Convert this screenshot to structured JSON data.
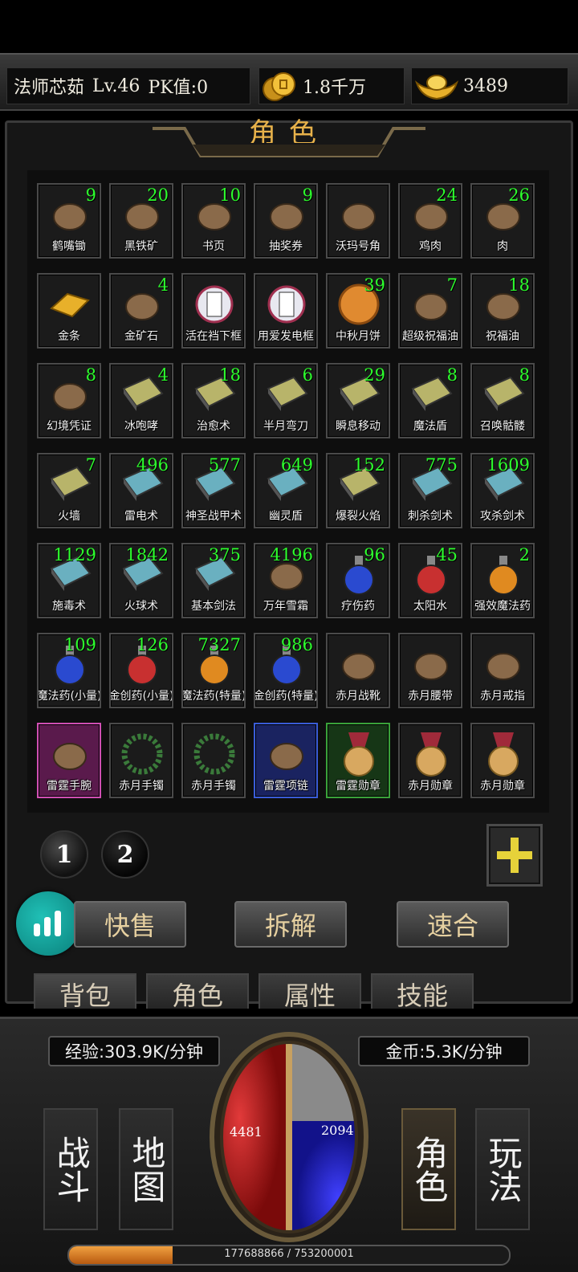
{
  "player": {
    "name": "法师芯茹",
    "level": "Lv.46",
    "pk": "PK值:0"
  },
  "currency": {
    "gold": "1.8千万",
    "ingot": "3489"
  },
  "panel_title": "角色",
  "items": [
    {
      "name": "鹤嘴锄",
      "count": "9",
      "icon": "pickaxe-icon"
    },
    {
      "name": "黑铁矿",
      "count": "20",
      "icon": "black-iron-ore-icon"
    },
    {
      "name": "书页",
      "count": "10",
      "icon": "book-page-icon"
    },
    {
      "name": "抽奖券",
      "count": "9",
      "icon": "lottery-ticket-icon"
    },
    {
      "name": "沃玛号角",
      "count": "",
      "icon": "horn-icon"
    },
    {
      "name": "鸡肉",
      "count": "24",
      "icon": "chicken-icon"
    },
    {
      "name": "肉",
      "count": "26",
      "icon": "meat-icon"
    },
    {
      "name": "金条",
      "count": "",
      "icon": "gold-bar-icon"
    },
    {
      "name": "金矿石",
      "count": "4",
      "icon": "gold-ore-icon"
    },
    {
      "name": "活在裆下框",
      "count": "",
      "icon": "frame-icon"
    },
    {
      "name": "用爱发电框",
      "count": "",
      "icon": "frame-icon"
    },
    {
      "name": "中秋月饼",
      "count": "39",
      "icon": "mooncake-icon"
    },
    {
      "name": "超级祝福油",
      "count": "7",
      "icon": "blessing-oil-icon"
    },
    {
      "name": "祝福油",
      "count": "18",
      "icon": "blessing-oil-icon"
    },
    {
      "name": "幻境凭证",
      "count": "8",
      "icon": "scroll-icon"
    },
    {
      "name": "冰咆哮",
      "count": "4",
      "icon": "skill-book-icon"
    },
    {
      "name": "治愈术",
      "count": "18",
      "icon": "skill-book-icon"
    },
    {
      "name": "半月弯刀",
      "count": "6",
      "icon": "skill-book-icon"
    },
    {
      "name": "瞬息移动",
      "count": "29",
      "icon": "skill-book-icon"
    },
    {
      "name": "魔法盾",
      "count": "8",
      "icon": "skill-book-icon"
    },
    {
      "name": "召唤骷髅",
      "count": "8",
      "icon": "skill-book-icon"
    },
    {
      "name": "火墙",
      "count": "7",
      "icon": "skill-book-icon"
    },
    {
      "name": "雷电术",
      "count": "496",
      "icon": "skill-book-icon"
    },
    {
      "name": "神圣战甲术",
      "count": "577",
      "icon": "skill-book-icon"
    },
    {
      "name": "幽灵盾",
      "count": "649",
      "icon": "skill-book-icon"
    },
    {
      "name": "爆裂火焰",
      "count": "152",
      "icon": "skill-book-icon"
    },
    {
      "name": "刺杀剑术",
      "count": "775",
      "icon": "skill-book-icon"
    },
    {
      "name": "攻杀剑术",
      "count": "1609",
      "icon": "skill-book-icon"
    },
    {
      "name": "施毒术",
      "count": "1129",
      "icon": "skill-book-icon"
    },
    {
      "name": "火球术",
      "count": "1842",
      "icon": "skill-book-icon"
    },
    {
      "name": "基本剑法",
      "count": "375",
      "icon": "skill-book-icon"
    },
    {
      "name": "万年雪霜",
      "count": "4196",
      "icon": "snow-frost-icon"
    },
    {
      "name": "疗伤药",
      "count": "96",
      "icon": "potion-icon"
    },
    {
      "name": "太阳水",
      "count": "45",
      "icon": "potion-icon"
    },
    {
      "name": "强效魔法药",
      "count": "2",
      "icon": "potion-icon"
    },
    {
      "name": "魔法药(小量)",
      "count": "109",
      "icon": "potion-icon"
    },
    {
      "name": "金创药(小量)",
      "count": "126",
      "icon": "potion-icon"
    },
    {
      "name": "魔法药(特量)",
      "count": "7327",
      "icon": "potion-icon"
    },
    {
      "name": "金创药(特量)",
      "count": "986",
      "icon": "potion-icon"
    },
    {
      "name": "赤月战靴",
      "count": "",
      "icon": "boots-icon"
    },
    {
      "name": "赤月腰带",
      "count": "",
      "icon": "belt-icon"
    },
    {
      "name": "赤月戒指",
      "count": "",
      "icon": "ring-icon"
    },
    {
      "name": "雷霆手腕",
      "count": "",
      "icon": "bracer-icon",
      "rarity": "purple"
    },
    {
      "name": "赤月手镯",
      "count": "",
      "icon": "bracelet-icon"
    },
    {
      "name": "赤月手镯",
      "count": "",
      "icon": "bracelet-icon"
    },
    {
      "name": "雷霆项链",
      "count": "",
      "icon": "necklace-icon",
      "rarity": "blue"
    },
    {
      "name": "雷霆勋章",
      "count": "",
      "icon": "medal-icon",
      "rarity": "green"
    },
    {
      "name": "赤月勋章",
      "count": "",
      "icon": "medal-icon"
    },
    {
      "name": "赤月勋章",
      "count": "",
      "icon": "medal-icon"
    }
  ],
  "pages": [
    "1",
    "2"
  ],
  "actions": {
    "sell": "快售",
    "disassemble": "拆解",
    "merge": "速合"
  },
  "tabs": [
    "背包",
    "角色",
    "属性",
    "技能"
  ],
  "hud": {
    "exp_rate": "经验:303.9K/分钟",
    "gold_rate": "金币:5.3K/分钟",
    "hp": "4481",
    "mp": "2094",
    "nav": {
      "fight": "战斗",
      "map": "地图",
      "role": "角色",
      "play": "玩法"
    },
    "xp_text": "177688866 / 753200001",
    "xp_fraction": 0.236
  },
  "colors": {
    "count": "#2dff2d",
    "title": "#e8b24a",
    "hp": "#c81e1e",
    "mp": "#2a2ad0"
  }
}
